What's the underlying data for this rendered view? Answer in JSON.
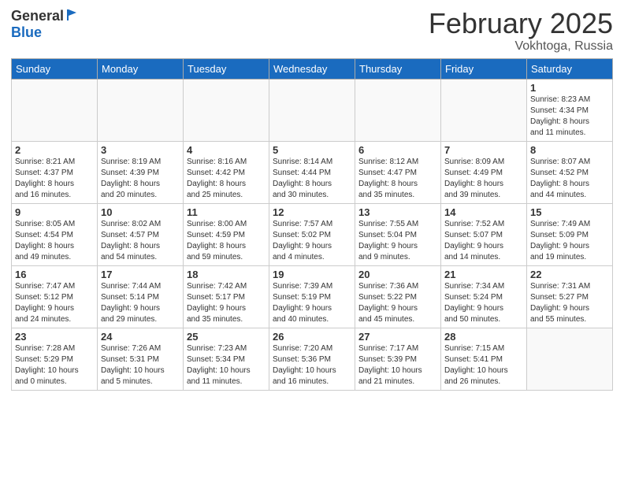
{
  "header": {
    "logo_line1": "General",
    "logo_line2": "Blue",
    "month_title": "February 2025",
    "subtitle": "Vokhtoga, Russia"
  },
  "weekdays": [
    "Sunday",
    "Monday",
    "Tuesday",
    "Wednesday",
    "Thursday",
    "Friday",
    "Saturday"
  ],
  "weeks": [
    [
      {
        "day": "",
        "detail": ""
      },
      {
        "day": "",
        "detail": ""
      },
      {
        "day": "",
        "detail": ""
      },
      {
        "day": "",
        "detail": ""
      },
      {
        "day": "",
        "detail": ""
      },
      {
        "day": "",
        "detail": ""
      },
      {
        "day": "1",
        "detail": "Sunrise: 8:23 AM\nSunset: 4:34 PM\nDaylight: 8 hours\nand 11 minutes."
      }
    ],
    [
      {
        "day": "2",
        "detail": "Sunrise: 8:21 AM\nSunset: 4:37 PM\nDaylight: 8 hours\nand 16 minutes."
      },
      {
        "day": "3",
        "detail": "Sunrise: 8:19 AM\nSunset: 4:39 PM\nDaylight: 8 hours\nand 20 minutes."
      },
      {
        "day": "4",
        "detail": "Sunrise: 8:16 AM\nSunset: 4:42 PM\nDaylight: 8 hours\nand 25 minutes."
      },
      {
        "day": "5",
        "detail": "Sunrise: 8:14 AM\nSunset: 4:44 PM\nDaylight: 8 hours\nand 30 minutes."
      },
      {
        "day": "6",
        "detail": "Sunrise: 8:12 AM\nSunset: 4:47 PM\nDaylight: 8 hours\nand 35 minutes."
      },
      {
        "day": "7",
        "detail": "Sunrise: 8:09 AM\nSunset: 4:49 PM\nDaylight: 8 hours\nand 39 minutes."
      },
      {
        "day": "8",
        "detail": "Sunrise: 8:07 AM\nSunset: 4:52 PM\nDaylight: 8 hours\nand 44 minutes."
      }
    ],
    [
      {
        "day": "9",
        "detail": "Sunrise: 8:05 AM\nSunset: 4:54 PM\nDaylight: 8 hours\nand 49 minutes."
      },
      {
        "day": "10",
        "detail": "Sunrise: 8:02 AM\nSunset: 4:57 PM\nDaylight: 8 hours\nand 54 minutes."
      },
      {
        "day": "11",
        "detail": "Sunrise: 8:00 AM\nSunset: 4:59 PM\nDaylight: 8 hours\nand 59 minutes."
      },
      {
        "day": "12",
        "detail": "Sunrise: 7:57 AM\nSunset: 5:02 PM\nDaylight: 9 hours\nand 4 minutes."
      },
      {
        "day": "13",
        "detail": "Sunrise: 7:55 AM\nSunset: 5:04 PM\nDaylight: 9 hours\nand 9 minutes."
      },
      {
        "day": "14",
        "detail": "Sunrise: 7:52 AM\nSunset: 5:07 PM\nDaylight: 9 hours\nand 14 minutes."
      },
      {
        "day": "15",
        "detail": "Sunrise: 7:49 AM\nSunset: 5:09 PM\nDaylight: 9 hours\nand 19 minutes."
      }
    ],
    [
      {
        "day": "16",
        "detail": "Sunrise: 7:47 AM\nSunset: 5:12 PM\nDaylight: 9 hours\nand 24 minutes."
      },
      {
        "day": "17",
        "detail": "Sunrise: 7:44 AM\nSunset: 5:14 PM\nDaylight: 9 hours\nand 29 minutes."
      },
      {
        "day": "18",
        "detail": "Sunrise: 7:42 AM\nSunset: 5:17 PM\nDaylight: 9 hours\nand 35 minutes."
      },
      {
        "day": "19",
        "detail": "Sunrise: 7:39 AM\nSunset: 5:19 PM\nDaylight: 9 hours\nand 40 minutes."
      },
      {
        "day": "20",
        "detail": "Sunrise: 7:36 AM\nSunset: 5:22 PM\nDaylight: 9 hours\nand 45 minutes."
      },
      {
        "day": "21",
        "detail": "Sunrise: 7:34 AM\nSunset: 5:24 PM\nDaylight: 9 hours\nand 50 minutes."
      },
      {
        "day": "22",
        "detail": "Sunrise: 7:31 AM\nSunset: 5:27 PM\nDaylight: 9 hours\nand 55 minutes."
      }
    ],
    [
      {
        "day": "23",
        "detail": "Sunrise: 7:28 AM\nSunset: 5:29 PM\nDaylight: 10 hours\nand 0 minutes."
      },
      {
        "day": "24",
        "detail": "Sunrise: 7:26 AM\nSunset: 5:31 PM\nDaylight: 10 hours\nand 5 minutes."
      },
      {
        "day": "25",
        "detail": "Sunrise: 7:23 AM\nSunset: 5:34 PM\nDaylight: 10 hours\nand 11 minutes."
      },
      {
        "day": "26",
        "detail": "Sunrise: 7:20 AM\nSunset: 5:36 PM\nDaylight: 10 hours\nand 16 minutes."
      },
      {
        "day": "27",
        "detail": "Sunrise: 7:17 AM\nSunset: 5:39 PM\nDaylight: 10 hours\nand 21 minutes."
      },
      {
        "day": "28",
        "detail": "Sunrise: 7:15 AM\nSunset: 5:41 PM\nDaylight: 10 hours\nand 26 minutes."
      },
      {
        "day": "",
        "detail": ""
      }
    ]
  ]
}
